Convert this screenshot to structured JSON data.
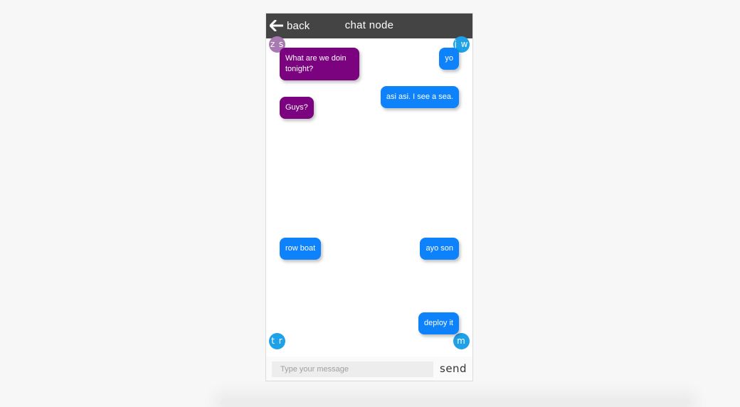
{
  "header": {
    "back_label": "back",
    "title": "chat node"
  },
  "avatars": {
    "top_left": "z s",
    "top_right": "j w",
    "bottom_left": "t r",
    "bottom_right": "m t"
  },
  "messages": {
    "zs_1": "What are we doin tonight?",
    "zs_2": "Guys?",
    "jw_1": "yo",
    "jw_2": "asi asi. I see a sea.",
    "tr_1": "row boat",
    "mt_1": "ayo son",
    "mt_2": "deploy it"
  },
  "composer": {
    "placeholder": "Type your message",
    "value": "",
    "send_label": "send"
  },
  "colors": {
    "header_bg": "#444444",
    "purple_bubble": "#7b037f",
    "blue_bubble": "#0d82fb",
    "purple_avatar": "#a97ab1",
    "blue_avatar": "#1ea1e6"
  },
  "icons": {
    "back": "arrow-left-icon"
  }
}
